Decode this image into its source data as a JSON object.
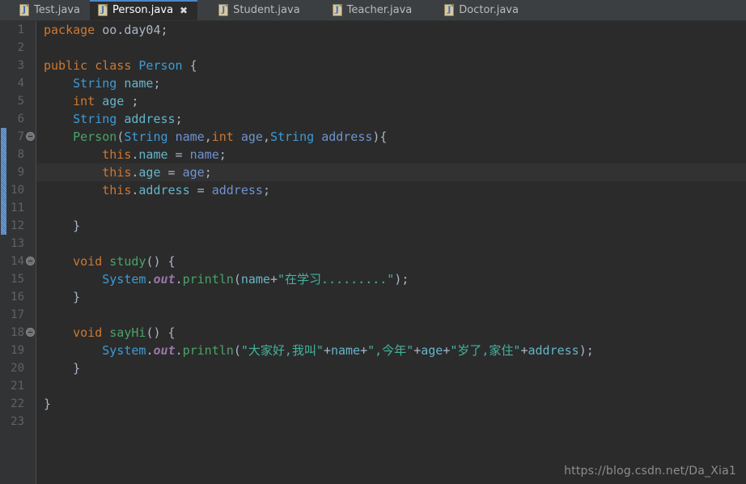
{
  "tabs": [
    {
      "label": "Test.java",
      "icon": "java-file-icon",
      "active": false,
      "closable": false
    },
    {
      "label": "Person.java",
      "icon": "java-file-icon",
      "active": true,
      "closable": true,
      "close_glyph": "✖"
    },
    {
      "label": "Student.java",
      "icon": "java-file-icon",
      "active": false,
      "closable": false
    },
    {
      "label": "Teacher.java",
      "icon": "java-file-icon",
      "active": false,
      "closable": false
    },
    {
      "label": "Doctor.java",
      "icon": "java-file-icon",
      "active": false,
      "closable": false
    }
  ],
  "editor": {
    "line_count": 23,
    "caret_line": 9,
    "fold_lines": [
      7,
      14,
      18
    ],
    "changed_lines": {
      "from": 7,
      "to": 12
    },
    "line_numbers": [
      "1",
      "2",
      "3",
      "4",
      "5",
      "6",
      "7",
      "8",
      "9",
      "10",
      "11",
      "12",
      "13",
      "14",
      "15",
      "16",
      "17",
      "18",
      "19",
      "20",
      "21",
      "22",
      "23"
    ],
    "lines": [
      {
        "n": 1,
        "text": "package oo.day04;",
        "tokens": [
          {
            "t": "package",
            "c": "kw"
          },
          {
            "t": " oo.day04;",
            "c": "pn"
          }
        ]
      },
      {
        "n": 2,
        "text": "",
        "tokens": []
      },
      {
        "n": 3,
        "text": "public class Person {",
        "tokens": [
          {
            "t": "public class ",
            "c": "kw"
          },
          {
            "t": "Person",
            "c": "type"
          },
          {
            "t": " {",
            "c": "pn"
          }
        ]
      },
      {
        "n": 4,
        "text": "    String name;",
        "tokens": [
          {
            "t": "    ",
            "c": "pn"
          },
          {
            "t": "String",
            "c": "type"
          },
          {
            "t": " ",
            "c": "pn"
          },
          {
            "t": "name",
            "c": "fld"
          },
          {
            "t": ";",
            "c": "pn"
          }
        ]
      },
      {
        "n": 5,
        "text": "    int age ;",
        "tokens": [
          {
            "t": "    ",
            "c": "pn"
          },
          {
            "t": "int",
            "c": "kw"
          },
          {
            "t": " ",
            "c": "pn"
          },
          {
            "t": "age",
            "c": "fld"
          },
          {
            "t": " ;",
            "c": "pn"
          }
        ]
      },
      {
        "n": 6,
        "text": "    String address;",
        "tokens": [
          {
            "t": "    ",
            "c": "pn"
          },
          {
            "t": "String",
            "c": "type"
          },
          {
            "t": " ",
            "c": "pn"
          },
          {
            "t": "address",
            "c": "fld"
          },
          {
            "t": ";",
            "c": "pn"
          }
        ]
      },
      {
        "n": 7,
        "text": "    Person(String name,int age,String address){",
        "tokens": [
          {
            "t": "    ",
            "c": "pn"
          },
          {
            "t": "Person",
            "c": "ctor"
          },
          {
            "t": "(",
            "c": "pn"
          },
          {
            "t": "String",
            "c": "type"
          },
          {
            "t": " ",
            "c": "pn"
          },
          {
            "t": "name",
            "c": "par"
          },
          {
            "t": ",",
            "c": "pn"
          },
          {
            "t": "int",
            "c": "kw"
          },
          {
            "t": " ",
            "c": "pn"
          },
          {
            "t": "age",
            "c": "par"
          },
          {
            "t": ",",
            "c": "pn"
          },
          {
            "t": "String",
            "c": "type"
          },
          {
            "t": " ",
            "c": "pn"
          },
          {
            "t": "address",
            "c": "par"
          },
          {
            "t": "){",
            "c": "pn"
          }
        ]
      },
      {
        "n": 8,
        "text": "        this.name = name;",
        "tokens": [
          {
            "t": "        ",
            "c": "pn"
          },
          {
            "t": "this",
            "c": "kw"
          },
          {
            "t": ".",
            "c": "pn"
          },
          {
            "t": "name",
            "c": "fld"
          },
          {
            "t": " = ",
            "c": "pn"
          },
          {
            "t": "name",
            "c": "par"
          },
          {
            "t": ";",
            "c": "pn"
          }
        ]
      },
      {
        "n": 9,
        "text": "        this.age = age;",
        "tokens": [
          {
            "t": "        ",
            "c": "pn"
          },
          {
            "t": "this",
            "c": "kw"
          },
          {
            "t": ".",
            "c": "pn"
          },
          {
            "t": "age",
            "c": "fld"
          },
          {
            "t": " = ",
            "c": "pn"
          },
          {
            "t": "age",
            "c": "par"
          },
          {
            "t": ";",
            "c": "pn"
          }
        ]
      },
      {
        "n": 10,
        "text": "        this.address = address;",
        "tokens": [
          {
            "t": "        ",
            "c": "pn"
          },
          {
            "t": "this",
            "c": "kw"
          },
          {
            "t": ".",
            "c": "pn"
          },
          {
            "t": "address",
            "c": "fld"
          },
          {
            "t": " = ",
            "c": "pn"
          },
          {
            "t": "address",
            "c": "par"
          },
          {
            "t": ";",
            "c": "pn"
          }
        ]
      },
      {
        "n": 11,
        "text": "",
        "tokens": []
      },
      {
        "n": 12,
        "text": "    }",
        "tokens": [
          {
            "t": "    }",
            "c": "pn"
          }
        ]
      },
      {
        "n": 13,
        "text": "",
        "tokens": []
      },
      {
        "n": 14,
        "text": "    void study() {",
        "tokens": [
          {
            "t": "    ",
            "c": "pn"
          },
          {
            "t": "void",
            "c": "kw"
          },
          {
            "t": " ",
            "c": "pn"
          },
          {
            "t": "study",
            "c": "ctor"
          },
          {
            "t": "() {",
            "c": "pn"
          }
        ]
      },
      {
        "n": 15,
        "text": "        System.out.println(name+\"在学习.........\");",
        "tokens": [
          {
            "t": "        ",
            "c": "pn"
          },
          {
            "t": "System",
            "c": "type"
          },
          {
            "t": ".",
            "c": "pn"
          },
          {
            "t": "out",
            "c": "stat"
          },
          {
            "t": ".",
            "c": "pn"
          },
          {
            "t": "println",
            "c": "mth"
          },
          {
            "t": "(",
            "c": "pn"
          },
          {
            "t": "name",
            "c": "fld"
          },
          {
            "t": "+",
            "c": "pn"
          },
          {
            "t": "\"在学习.........\"",
            "c": "str"
          },
          {
            "t": ");",
            "c": "pn"
          }
        ]
      },
      {
        "n": 16,
        "text": "    }",
        "tokens": [
          {
            "t": "    }",
            "c": "pn"
          }
        ]
      },
      {
        "n": 17,
        "text": "",
        "tokens": []
      },
      {
        "n": 18,
        "text": "    void sayHi() {",
        "tokens": [
          {
            "t": "    ",
            "c": "pn"
          },
          {
            "t": "void",
            "c": "kw"
          },
          {
            "t": " ",
            "c": "pn"
          },
          {
            "t": "sayHi",
            "c": "ctor"
          },
          {
            "t": "() {",
            "c": "pn"
          }
        ]
      },
      {
        "n": 19,
        "text": "        System.out.println(\"大家好,我叫\"+name+\",今年\"+age+\"岁了,家住\"+address);",
        "tokens": [
          {
            "t": "        ",
            "c": "pn"
          },
          {
            "t": "System",
            "c": "type"
          },
          {
            "t": ".",
            "c": "pn"
          },
          {
            "t": "out",
            "c": "stat"
          },
          {
            "t": ".",
            "c": "pn"
          },
          {
            "t": "println",
            "c": "mth"
          },
          {
            "t": "(",
            "c": "pn"
          },
          {
            "t": "\"大家好,我叫\"",
            "c": "str"
          },
          {
            "t": "+",
            "c": "pn"
          },
          {
            "t": "name",
            "c": "fld"
          },
          {
            "t": "+",
            "c": "pn"
          },
          {
            "t": "\",今年\"",
            "c": "str"
          },
          {
            "t": "+",
            "c": "pn"
          },
          {
            "t": "age",
            "c": "fld"
          },
          {
            "t": "+",
            "c": "pn"
          },
          {
            "t": "\"岁了,家住\"",
            "c": "str"
          },
          {
            "t": "+",
            "c": "pn"
          },
          {
            "t": "address",
            "c": "fld"
          },
          {
            "t": ");",
            "c": "pn"
          }
        ]
      },
      {
        "n": 20,
        "text": "    }",
        "tokens": [
          {
            "t": "    }",
            "c": "pn"
          }
        ]
      },
      {
        "n": 21,
        "text": "",
        "tokens": []
      },
      {
        "n": 22,
        "text": "}",
        "tokens": [
          {
            "t": "}",
            "c": "pn"
          }
        ]
      },
      {
        "n": 23,
        "text": "",
        "tokens": []
      }
    ]
  },
  "watermark": {
    "text": "https://blog.csdn.net/Da_Xia1"
  },
  "colors": {
    "tabbar_bg": "#3c3f41",
    "editor_bg": "#2b2b2b",
    "gutter_bg": "#313335",
    "caret_line_bg": "#323232",
    "active_tab_accent": "#4a88c7",
    "change_marker": "#3b75b5",
    "keyword": "#cc7832",
    "type": "#3d9bd6",
    "method": "#4aa36a",
    "field": "#64b5c9",
    "parameter": "#6f93d0",
    "string": "#45b39d",
    "static_field": "#9876aa",
    "default_text": "#a9b7c6",
    "line_number": "#606366"
  }
}
